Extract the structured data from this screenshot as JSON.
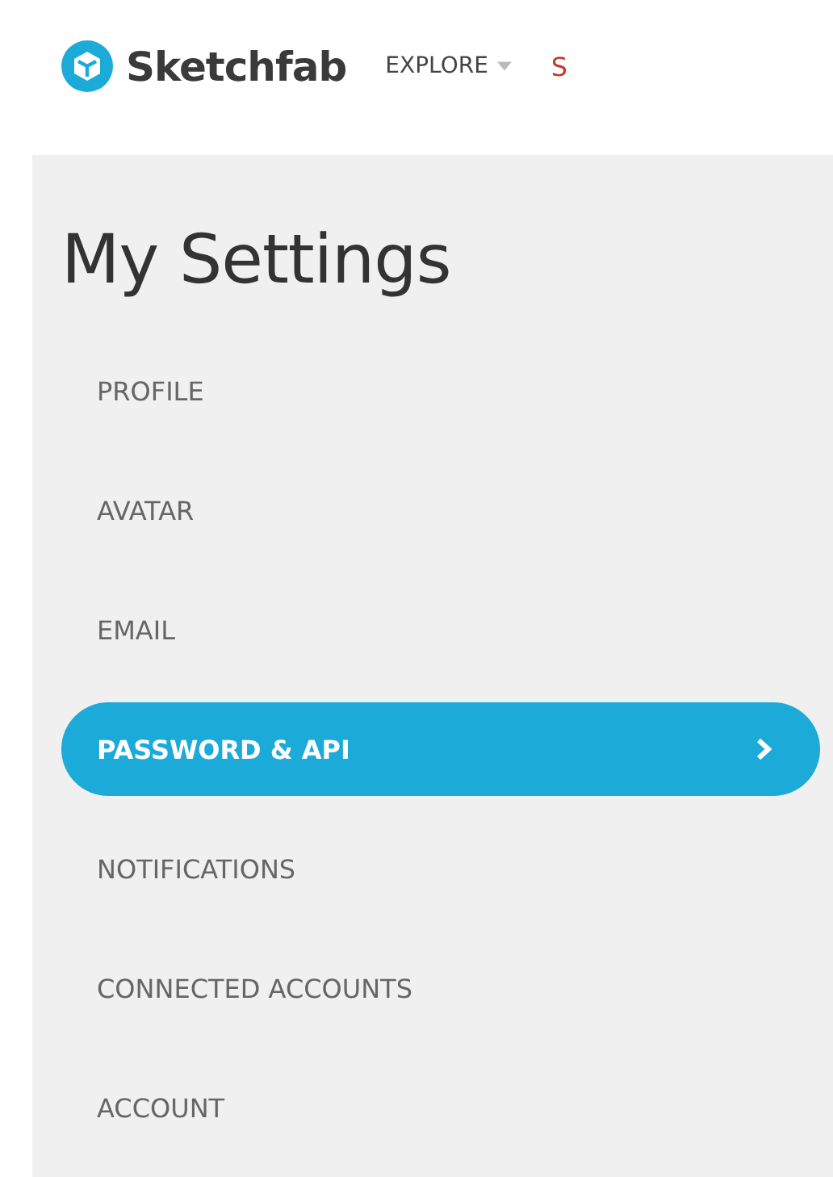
{
  "header": {
    "logo": "Sketchfab",
    "nav": [
      {
        "label": "EXPLORE",
        "dropdown": true,
        "kind": "menu"
      },
      {
        "label": "S",
        "dropdown": false,
        "kind": "accent"
      }
    ]
  },
  "title": "My Settings",
  "menu": [
    {
      "label": "PROFILE",
      "selected": false
    },
    {
      "label": "AVATAR",
      "selected": false
    },
    {
      "label": "EMAIL",
      "selected": false
    },
    {
      "label": "PASSWORD & API",
      "selected": true
    },
    {
      "label": "NOTIFICATIONS",
      "selected": false
    },
    {
      "label": "CONNECTED ACCOUNTS",
      "selected": false
    },
    {
      "label": "ACCOUNT",
      "selected": false
    }
  ]
}
